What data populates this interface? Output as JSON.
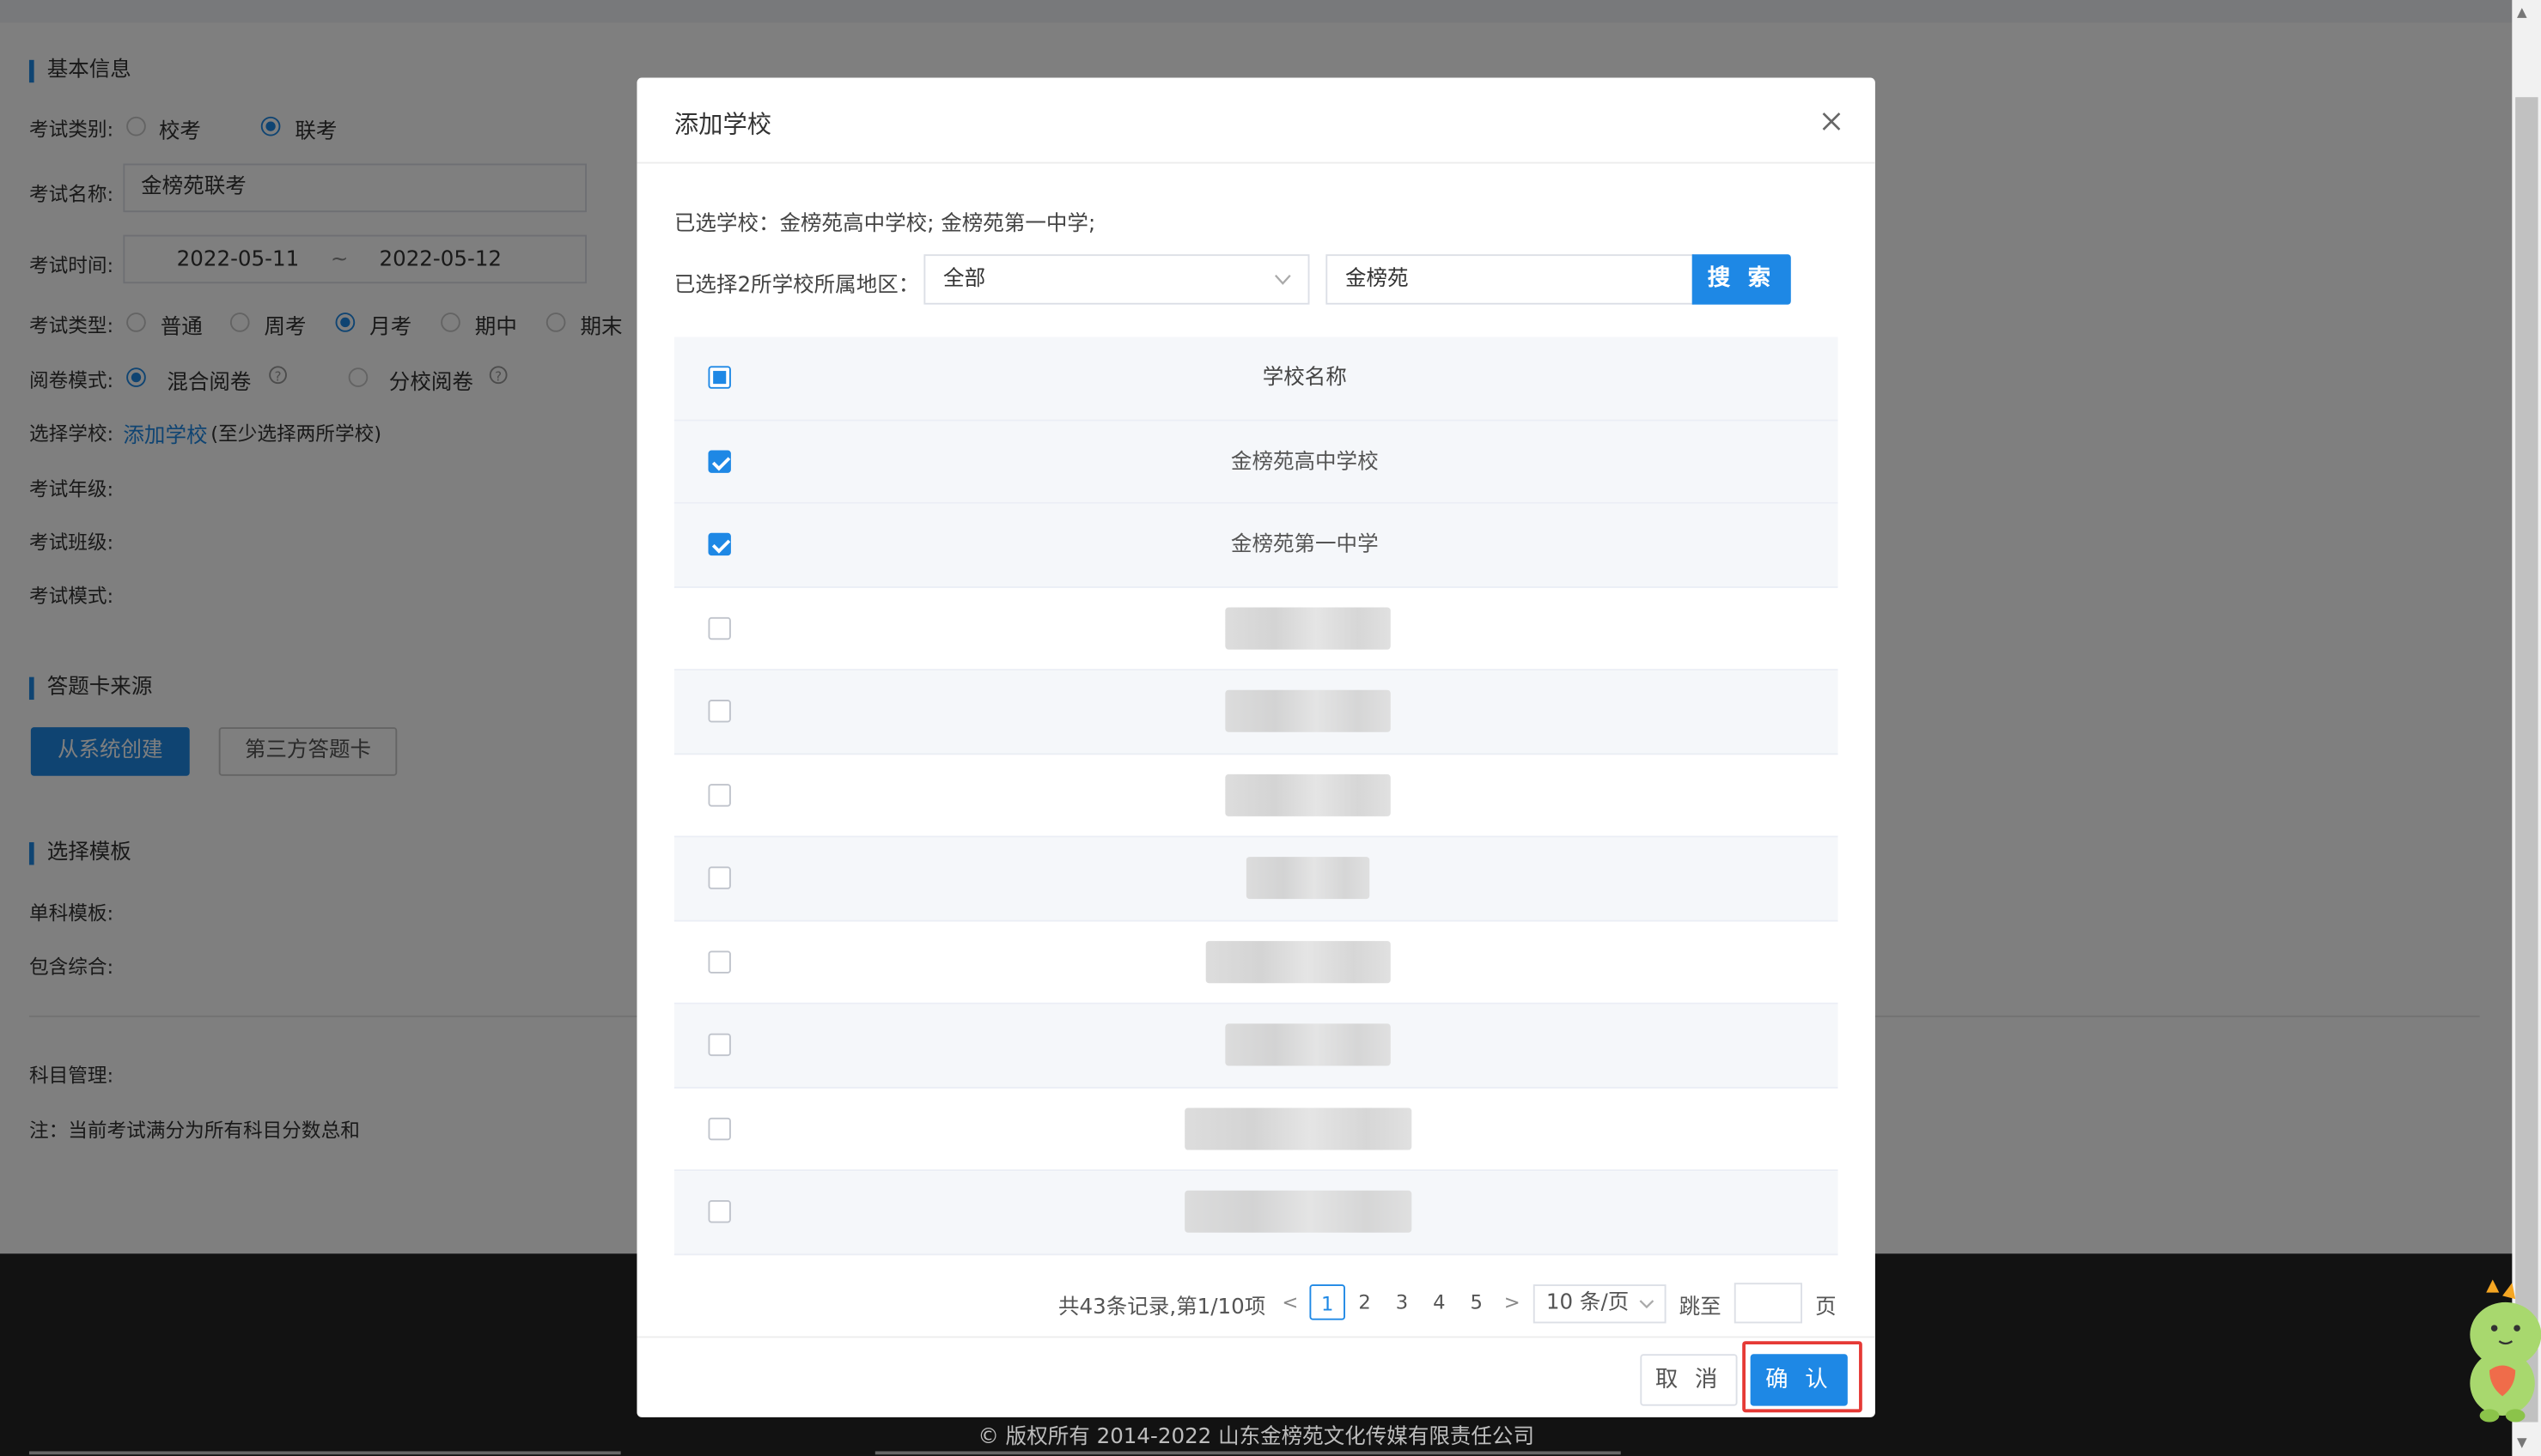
{
  "background": {
    "basic_info_title": "基本信息",
    "exam_category_label": "考试类别:",
    "exam_category_options": [
      "校考",
      "联考"
    ],
    "exam_name_label": "考试名称:",
    "exam_name_value": "金榜苑联考",
    "exam_time_label": "考试时间:",
    "exam_time_start": "2022-05-11",
    "exam_time_sep": "~",
    "exam_time_end": "2022-05-12",
    "exam_type_label": "考试类型:",
    "exam_type_options": [
      "普通",
      "周考",
      "月考",
      "期中",
      "期末"
    ],
    "grading_mode_label": "阅卷模式:",
    "grading_mode_options": [
      "混合阅卷",
      "分校阅卷"
    ],
    "select_school_label": "选择学校:",
    "add_school_link": "添加学校",
    "add_school_hint": "(至少选择两所学校)",
    "exam_grade_label": "考试年级:",
    "exam_class_label": "考试班级:",
    "exam_mode_label": "考试模式:",
    "answer_card_title": "答题卡来源",
    "create_from_system": "从系统创建",
    "third_party_card": "第三方答题卡",
    "template_title": "选择模板",
    "single_template_label": "单科模板:",
    "combined_label": "包含综合:",
    "subject_mgmt_label": "科目管理:",
    "note": "注：当前考试满分为所有科目分数总和",
    "footer": "© 版权所有 2014-2022 山东金榜苑文化传媒有限责任公司",
    "help_glyph": "?"
  },
  "modal": {
    "title": "添加学校",
    "selected_text": "已选学校：金榜苑高中学校; 金榜苑第一中学;",
    "region_label": "已选择2所学校所属地区：",
    "region_value": "全部",
    "search_value": "金榜苑",
    "search_button": "搜 索",
    "table": {
      "header": "学校名称",
      "rows": [
        {
          "name": "金榜苑高中学校",
          "checked": true
        },
        {
          "name": "金榜苑第一中学",
          "checked": true
        },
        {
          "name": "",
          "checked": false
        },
        {
          "name": "",
          "checked": false
        },
        {
          "name": "",
          "checked": false
        },
        {
          "name": "",
          "checked": false
        },
        {
          "name": "",
          "checked": false
        },
        {
          "name": "",
          "checked": false
        },
        {
          "name": "",
          "checked": false
        },
        {
          "name": "",
          "checked": false
        }
      ]
    },
    "pagination": {
      "total": "共43条记录,第1/10项",
      "prev": "<",
      "pages": [
        "1",
        "2",
        "3",
        "4",
        "5"
      ],
      "next": ">",
      "page_size": "10 条/页",
      "jump_label": "跳至",
      "page_label": "页"
    },
    "cancel_button": "取 消",
    "confirm_button": "确 认"
  },
  "colors": {
    "accent": "#1e88e5",
    "highlight": "#e53935"
  }
}
